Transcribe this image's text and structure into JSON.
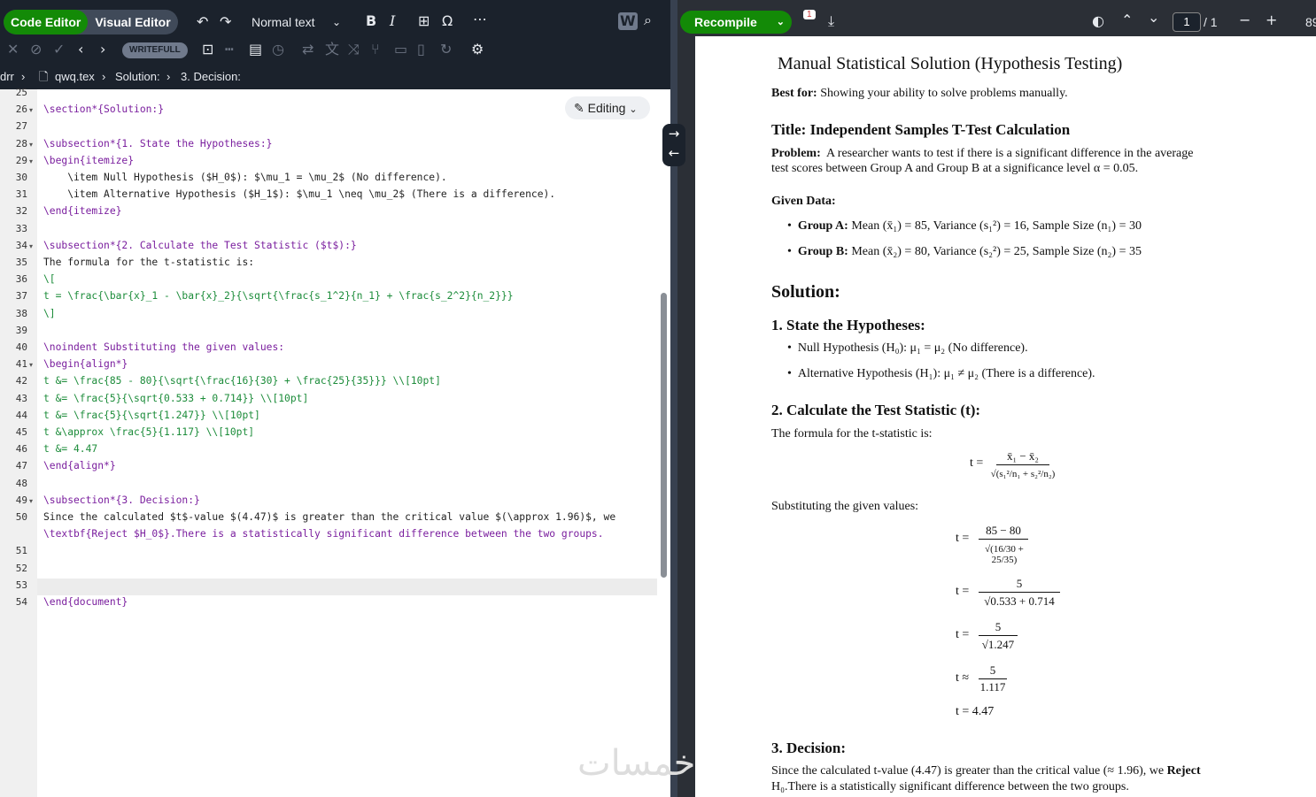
{
  "toolbar": {
    "code_editor": "Code Editor",
    "visual_editor": "Visual Editor",
    "text_style": "Normal text",
    "writefull": "WRITEFULL"
  },
  "breadcrumb": {
    "root": "drr",
    "file": "qwq.tex",
    "section": "Solution:",
    "subsection": "3. Decision:"
  },
  "editor": {
    "mode_label": "Editing",
    "lines": [
      {
        "n": "25",
        "text": ""
      },
      {
        "n": "26",
        "text": "\\section*{Solution:}"
      },
      {
        "n": "27",
        "text": ""
      },
      {
        "n": "28",
        "text": "\\subsection*{1. State the Hypotheses:}"
      },
      {
        "n": "29",
        "text": "\\begin{itemize}"
      },
      {
        "n": "30",
        "text": "    \\item Null Hypothesis ($H_0$): $\\mu_1 = \\mu_2$ (No difference)."
      },
      {
        "n": "31",
        "text": "    \\item Alternative Hypothesis ($H_1$): $\\mu_1 \\neq \\mu_2$ (There is a difference)."
      },
      {
        "n": "32",
        "text": "\\end{itemize}"
      },
      {
        "n": "33",
        "text": ""
      },
      {
        "n": "34",
        "text": "\\subsection*{2. Calculate the Test Statistic ($t$):}"
      },
      {
        "n": "35",
        "text": "The formula for the t-statistic is:"
      },
      {
        "n": "36",
        "text": "\\["
      },
      {
        "n": "37",
        "text": "t = \\frac{\\bar{x}_1 - \\bar{x}_2}{\\sqrt{\\frac{s_1^2}{n_1} + \\frac{s_2^2}{n_2}}}"
      },
      {
        "n": "38",
        "text": "\\]"
      },
      {
        "n": "39",
        "text": ""
      },
      {
        "n": "40",
        "text": "\\noindent Substituting the given values:"
      },
      {
        "n": "41",
        "text": "\\begin{align*}"
      },
      {
        "n": "42",
        "text": "t &= \\frac{85 - 80}{\\sqrt{\\frac{16}{30} + \\frac{25}{35}}} \\\\[10pt]"
      },
      {
        "n": "43",
        "text": "t &= \\frac{5}{\\sqrt{0.533 + 0.714}} \\\\[10pt]"
      },
      {
        "n": "44",
        "text": "t &= \\frac{5}{\\sqrt{1.247}} \\\\[10pt]"
      },
      {
        "n": "45",
        "text": "t &\\approx \\frac{5}{1.117} \\\\[10pt]"
      },
      {
        "n": "46",
        "text": "t &= 4.47"
      },
      {
        "n": "47",
        "text": "\\end{align*}"
      },
      {
        "n": "48",
        "text": ""
      },
      {
        "n": "49",
        "text": "\\subsection*{3. Decision:}"
      },
      {
        "n": "50",
        "text": "Since the calculated $t$-value $(4.47)$ is greater than the critical value $(\\approx 1.96)$, we"
      },
      {
        "n": "50b",
        "text": "\\textbf{Reject $H_0$}.There is a statistically significant difference between the two groups."
      },
      {
        "n": "51",
        "text": ""
      },
      {
        "n": "52",
        "text": ""
      },
      {
        "n": "53",
        "text": ""
      },
      {
        "n": "54",
        "text": "\\end{document}"
      }
    ]
  },
  "preview_toolbar": {
    "recompile": "Recompile",
    "badge": "1",
    "page_current": "1",
    "page_total": "/ 1",
    "zoom": "89"
  },
  "preview": {
    "title": "Manual Statistical Solution (Hypothesis Testing)",
    "best_for_label": "Best for:",
    "best_for_text": "Showing your ability to solve problems manually.",
    "subtitle": "Title: Independent Samples T-Test Calculation",
    "problem_label": "Problem:",
    "problem_line1": "A researcher wants to test if there is a significant difference in the average",
    "problem_line2": "test scores between Group A and Group B at a significance level α = 0.05.",
    "given_label": "Given Data:",
    "group_a_label": "Group A:",
    "group_a_text": "Mean (x̄₁) = 85, Variance (s₁²) = 16, Sample Size (n₁) = 30",
    "group_b_label": "Group B:",
    "group_b_text": "Mean (x̄₂) = 80, Variance (s₂²) = 25, Sample Size (n₂) = 35",
    "solution": "Solution:",
    "h_step1": "1.  State the Hypotheses:",
    "null_h": "Null Hypothesis (H₀): μ₁ = μ₂ (No difference).",
    "alt_h": "Alternative Hypothesis (H₁): μ₁ ≠ μ₂ (There is a difference).",
    "h_step2": "2.  Calculate the Test Statistic (t):",
    "formula_intro": "The formula for the t-statistic is:",
    "f_num": "x̄₁ − x̄₂",
    "f_den": "√(s₁²/n₁ + s₂²/n₂)",
    "subst_intro": "Substituting the given values:",
    "e1_num": "85 − 80",
    "e1_den": "√(16/30 + 25/35)",
    "e2_num": "5",
    "e2_den": "√0.533 + 0.714",
    "e3_num": "5",
    "e3_den": "√1.247",
    "e4_num": "5",
    "e4_den": "1.117",
    "e5": "t = 4.47",
    "t_eq": "t =",
    "t_approx": "t ≈",
    "h_step3": "3.  Decision:",
    "decision_line1": "Since the calculated t-value (4.47) is greater than the critical value (≈ 1.96), we",
    "reject": "Reject",
    "decision_line2": "H₀.There is a statistically significant difference between the two groups."
  },
  "watermark": "خمسات"
}
